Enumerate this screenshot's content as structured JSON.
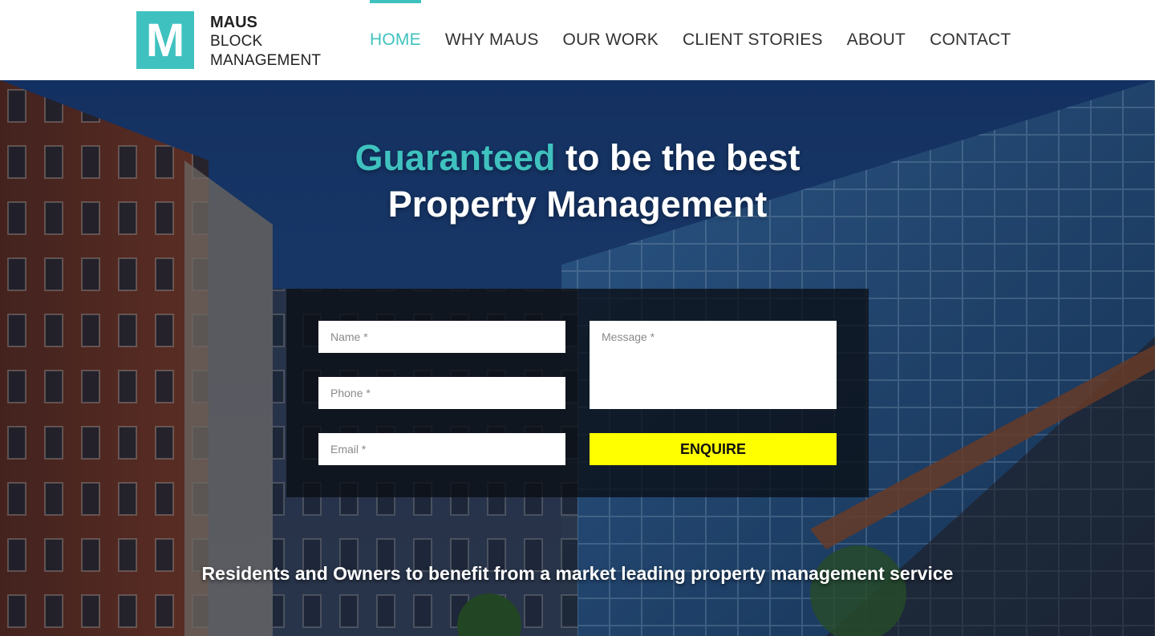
{
  "brand": {
    "logo_letter": "M",
    "name_line1": "MAUS",
    "name_line2": "BLOCK",
    "name_line3": "MANAGEMENT",
    "accent_color": "#3fc2bf"
  },
  "nav": {
    "items": [
      {
        "label": "HOME",
        "active": true
      },
      {
        "label": "WHY MAUS",
        "active": false
      },
      {
        "label": "OUR WORK",
        "active": false
      },
      {
        "label": "CLIENT STORIES",
        "active": false
      },
      {
        "label": "ABOUT",
        "active": false
      },
      {
        "label": "CONTACT",
        "active": false
      }
    ]
  },
  "hero": {
    "headline_accent": "Guaranteed",
    "headline_rest": " to be the best",
    "headline_line2": "Property Management",
    "tagline": "Residents and Owners to benefit from a market leading property management service"
  },
  "form": {
    "name_placeholder": "Name *",
    "phone_placeholder": "Phone *",
    "email_placeholder": "Email *",
    "message_placeholder": "Message *",
    "submit_label": "ENQUIRE",
    "submit_color": "#ffff00"
  }
}
